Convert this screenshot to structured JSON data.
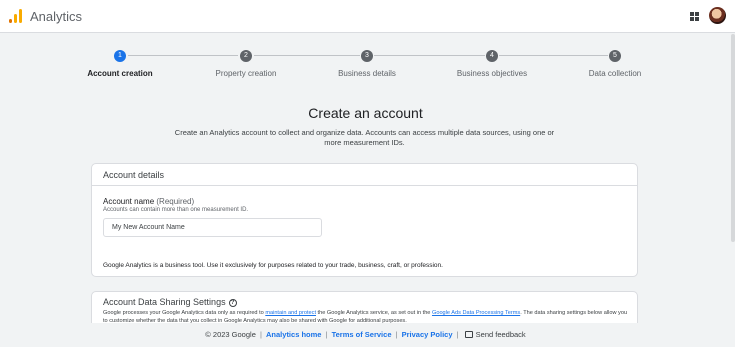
{
  "app": {
    "title": "Analytics",
    "logo_icon": "analytics-logo-icon",
    "brand_colors": [
      "#f9ab00",
      "#e37400"
    ]
  },
  "header": {
    "apps_icon": "apps-grid-icon",
    "avatar": "user-avatar"
  },
  "stepper": {
    "steps": [
      {
        "number": "1",
        "label": "Account creation"
      },
      {
        "number": "2",
        "label": "Property creation"
      },
      {
        "number": "3",
        "label": "Business details"
      },
      {
        "number": "4",
        "label": "Business objectives"
      },
      {
        "number": "5",
        "label": "Data collection"
      }
    ],
    "active_step": 1,
    "active_color": "#1a73e8"
  },
  "main": {
    "title": "Create an account",
    "description": "Create an Analytics account to collect and organize data. Accounts can access multiple data sources, using one or more measurement IDs."
  },
  "account_details": {
    "heading": "Account details",
    "name_label": "Account name",
    "name_required": "(Required)",
    "name_hint": "Accounts can contain more than one measurement ID.",
    "name_value": "My New Account Name",
    "note": "Google Analytics is a business tool. Use it exclusively for purposes related to your trade, business, craft, or profession."
  },
  "data_sharing": {
    "heading": "Account Data Sharing Settings",
    "help_icon": "help-icon",
    "text_1": "Google processes your Google Analytics data only as required to ",
    "link_1": "maintain and protect",
    "text_2": " the Google Analytics service, as set out in the ",
    "link_2": "Google Ads Data Processing Terms",
    "text_3": ". The data sharing settings below allow you to customize whether the data that you collect in Google Analytics may also be shared with Google for additional purposes."
  },
  "footer": {
    "copyright": "© 2023 Google",
    "home_link": "Analytics home",
    "terms_link": "Terms of Service",
    "privacy_link": "Privacy Policy",
    "feedback_label": "Send feedback",
    "separator": "|"
  }
}
